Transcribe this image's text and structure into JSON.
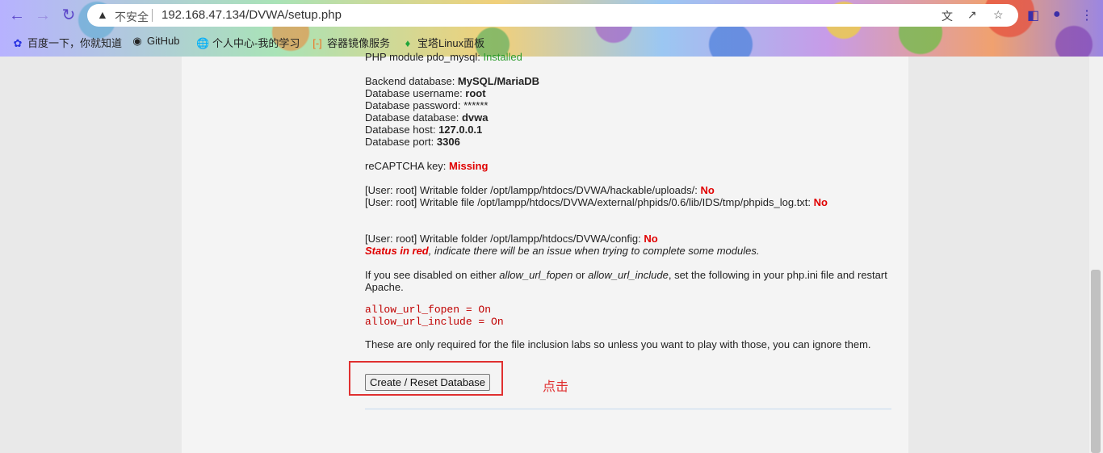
{
  "browser": {
    "security_label": "不安全",
    "url": "192.168.47.134/DVWA/setup.php",
    "bookmarks": [
      {
        "label": "百度一下，你就知道",
        "icon": "paw-icon"
      },
      {
        "label": "GitHub",
        "icon": "github-icon"
      },
      {
        "label": "个人中心-我的学习",
        "icon": "globe-icon"
      },
      {
        "label": "容器镜像服务",
        "icon": "bracket-icon"
      },
      {
        "label": "宝塔Linux面板",
        "icon": "shield-icon"
      }
    ]
  },
  "setup": {
    "cut_line": {
      "label": "PHP module pdo_mysql: ",
      "value": "Installed"
    },
    "backend": {
      "label": "Backend database: ",
      "value": "MySQL/MariaDB"
    },
    "username": {
      "label": "Database username: ",
      "value": "root"
    },
    "password": {
      "label": "Database password: ",
      "value": "******"
    },
    "database": {
      "label": "Database database: ",
      "value": "dvwa"
    },
    "host": {
      "label": "Database host: ",
      "value": "127.0.0.1"
    },
    "port": {
      "label": "Database port: ",
      "value": "3306"
    },
    "recaptcha": {
      "label": "reCAPTCHA key: ",
      "value": "Missing"
    },
    "writable_uploads": {
      "label": "[User: root] Writable folder /opt/lampp/htdocs/DVWA/hackable/uploads/: ",
      "value": "No"
    },
    "writable_phpids": {
      "label": "[User: root] Writable file /opt/lampp/htdocs/DVWA/external/phpids/0.6/lib/IDS/tmp/phpids_log.txt: ",
      "value": "No"
    },
    "writable_config": {
      "label": "[User: root] Writable folder /opt/lampp/htdocs/DVWA/config: ",
      "value": "No"
    },
    "status_note": {
      "strong": "Status in red",
      "rest": ", indicate there will be an issue when trying to complete some modules."
    },
    "disabled_note": {
      "part1": "If you see disabled on either ",
      "opt1": "allow_url_fopen",
      "part2": " or ",
      "opt2": "allow_url_include",
      "part3": ", set the following in your php.ini file and restart",
      "line2": "Apache."
    },
    "code_lines": [
      "allow_url_fopen = On",
      "allow_url_include = On"
    ],
    "ignore_note": "These are only required for the file inclusion labs so unless you want to play with those, you can ignore them.",
    "button_label": "Create / Reset Database"
  },
  "annotation": {
    "text": "点击",
    "color": "#e03030"
  }
}
